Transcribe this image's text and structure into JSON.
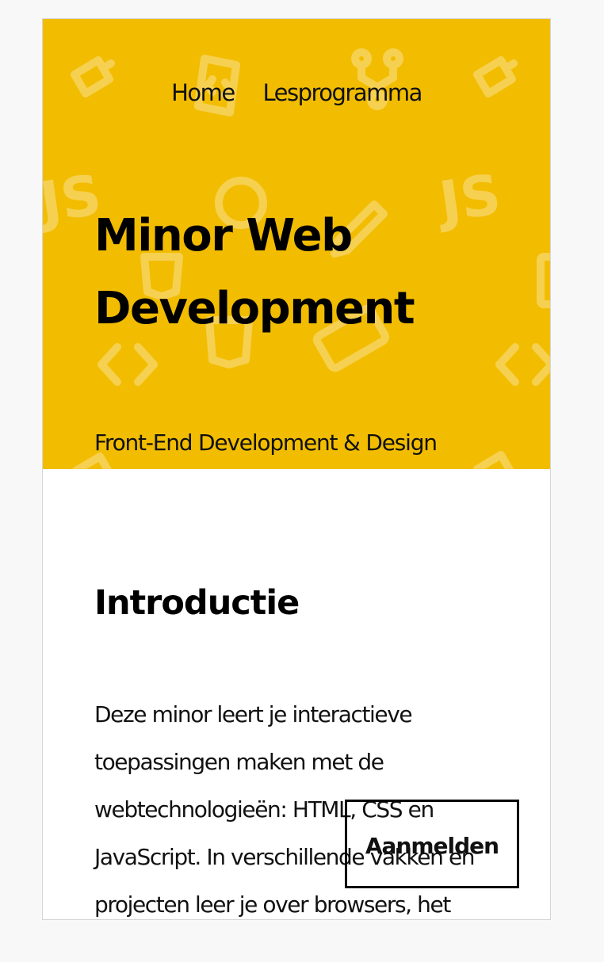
{
  "nav": {
    "items": [
      {
        "label": "Home"
      },
      {
        "label": "Lesprogramma"
      }
    ]
  },
  "hero": {
    "title": "Minor Web Development",
    "subtitle": "Front-End Development & Design",
    "background_color": "#f2bd00",
    "pattern_icons": [
      "coffee-cup-icon",
      "code-file-icon",
      "git-branch-icon",
      "js-logo-icon",
      "github-logo-icon",
      "html5-shield-icon",
      "keyboard-icon",
      "code-brackets-icon",
      "pencil-icon"
    ]
  },
  "intro": {
    "heading": "Introductie",
    "text": "Deze minor leert je interactieve toepassingen maken met de webtechnologieën: HTML, CSS en JavaScript. In verschillende vakken en projecten leer je over browsers, het"
  },
  "cta": {
    "label": "Aanmelden"
  }
}
